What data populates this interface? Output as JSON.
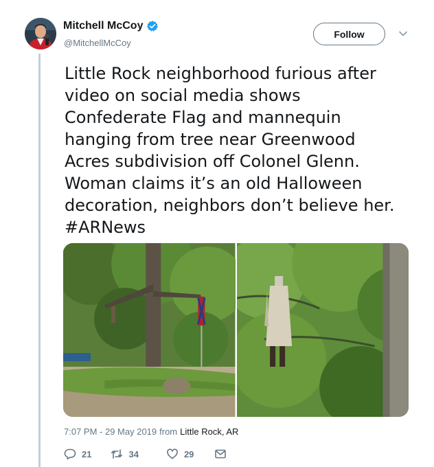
{
  "tweet": {
    "author": {
      "display_name": "Mitchell McCoy",
      "handle": "@MitchellMcCoy",
      "verified": true
    },
    "follow_label": "Follow",
    "text_lines": [
      "Little Rock neighborhood furious after",
      "video on social media shows",
      "Confederate Flag and mannequin",
      "hanging from tree near Greenwood",
      "Acres subdivision off Colonel Glenn.",
      "Woman claims it’s an old Halloween",
      "decoration, neighbors don’t believe her.",
      "#ARNews"
    ],
    "timestamp": "7:07 PM - 29 May 2019",
    "location_prefix": "from",
    "location": "Little Rock, AR",
    "counts": {
      "replies": "21",
      "retweets": "34",
      "likes": "29"
    },
    "icons": {
      "verified": "verified-badge-icon",
      "caret": "chevron-down-icon",
      "reply": "reply-icon",
      "retweet": "retweet-icon",
      "like": "heart-icon",
      "dm": "envelope-icon"
    },
    "colors": {
      "accent": "#1da1f2",
      "text": "#14171a",
      "secondary": "#657786",
      "hashtag": "#14171a"
    }
  }
}
